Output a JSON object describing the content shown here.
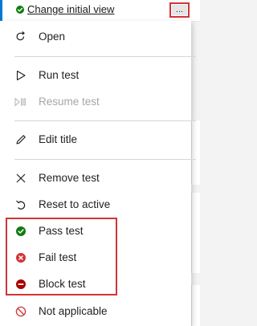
{
  "header_row": {
    "link_text": "Change initial view",
    "more_button_glyph": "...",
    "status_icon": "check-circle-icon"
  },
  "menu": {
    "open": "Open",
    "run_test": "Run test",
    "resume_test": "Resume test",
    "edit_title": "Edit title",
    "remove_test": "Remove test",
    "reset_to_active": "Reset to active",
    "pass_test": "Pass test",
    "fail_test": "Fail test",
    "block_test": "Block test",
    "not_applicable": "Not applicable"
  },
  "colors": {
    "pass": "#107c10",
    "fail": "#d13438",
    "block": "#a80000",
    "highlight_border": "#d13438",
    "accent": "#0078d4"
  }
}
